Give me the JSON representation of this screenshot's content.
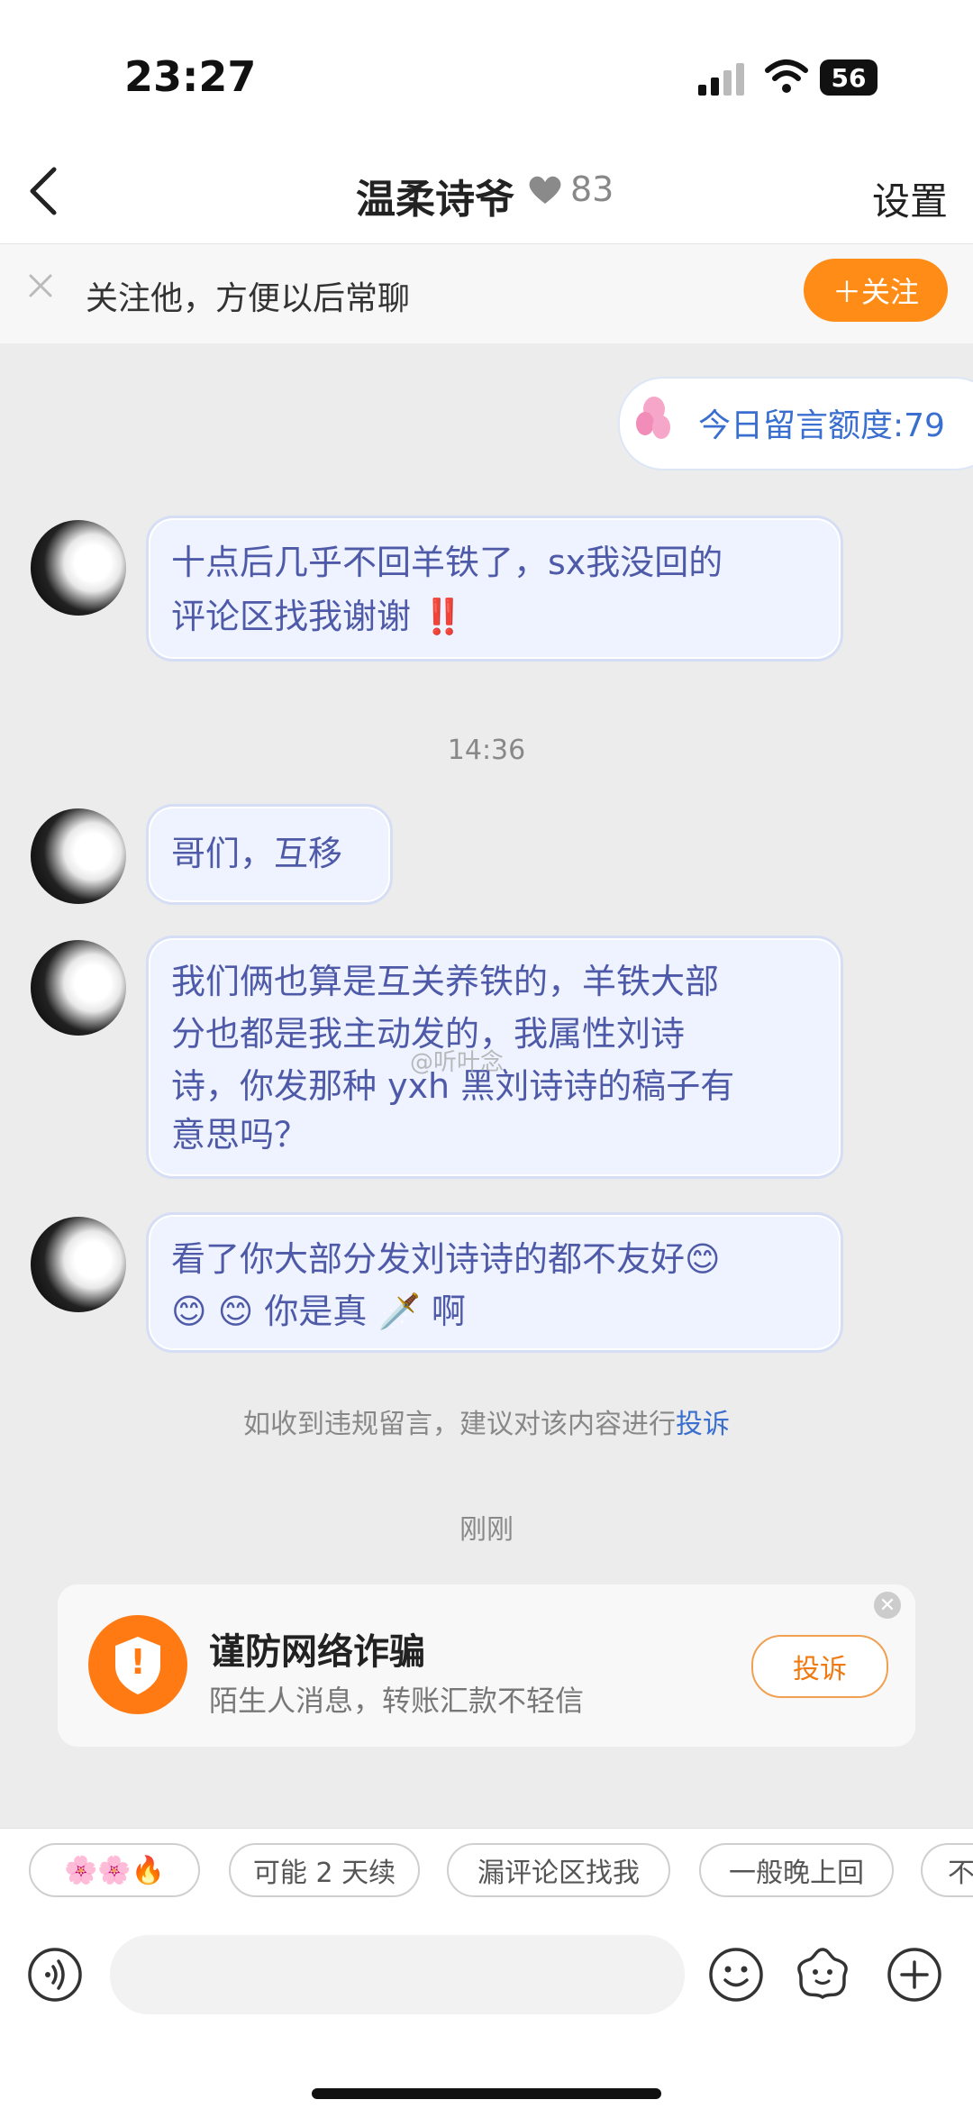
{
  "status_bar": {
    "time": "23:27",
    "battery": "56"
  },
  "header": {
    "title": "温柔诗爷",
    "level": "83",
    "settings_label": "设置"
  },
  "follow_banner": {
    "text": "关注他，方便以后常聊",
    "button_label": "＋关注"
  },
  "quota": {
    "text": "今日留言额度:79"
  },
  "messages": [
    {
      "line1": "十点后几乎不回羊铁了，sx我没回的",
      "line2": "评论区找我谢谢 ‼️"
    },
    {
      "line1": "哥们，互移"
    },
    {
      "line1": "我们俩也算是互关养铁的，羊铁大部",
      "line2": "分也都是我主动发的，我属性刘诗",
      "line3": "诗，你发那种 yxh 黑刘诗诗的稿子有",
      "line4": "意思吗？"
    },
    {
      "line1": "看了你大部分发刘诗诗的都不友好😊",
      "line2": "😊 😊 你是真 🗡️ 啊"
    }
  ],
  "timestamps": {
    "t1": "14:36",
    "t2": "刚刚"
  },
  "watermark": "@听叶念",
  "notice": {
    "text": "如收到违规留言，建议对该内容进行",
    "link": "投诉"
  },
  "fraud_card": {
    "title": "谨防网络诈骗",
    "subtitle": "陌生人消息，转账汇款不轻信",
    "button_label": "投诉",
    "icon_symbol": "!"
  },
  "quick_replies": [
    "🌸🌸🔥",
    "可能 2 天续",
    "漏评论区找我",
    "一般晚上回",
    "不"
  ],
  "colors": {
    "accent_orange": "#ff8c16",
    "link_blue": "#3a6fd0",
    "bubble_text": "#4e5aa8"
  }
}
